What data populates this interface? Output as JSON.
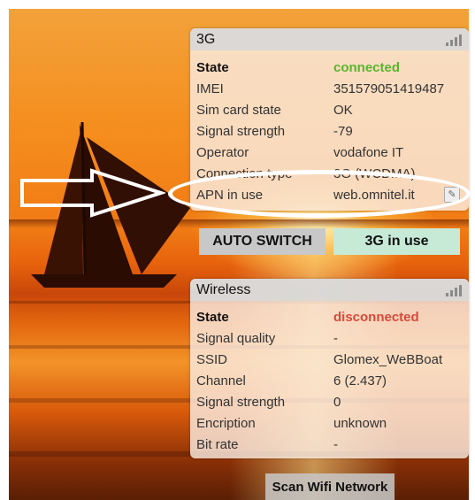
{
  "threeg": {
    "title": "3G",
    "rows": [
      {
        "label": "State",
        "value": "connected"
      },
      {
        "label": "IMEI",
        "value": "351579051419487"
      },
      {
        "label": "Sim card state",
        "value": "OK"
      },
      {
        "label": "Signal strength",
        "value": "-79"
      },
      {
        "label": "Operator",
        "value": "vodafone IT"
      },
      {
        "label": "Connection type",
        "value": "3G (WCDMA)"
      },
      {
        "label": "APN in use",
        "value": "web.omnitel.it"
      }
    ]
  },
  "buttons": {
    "auto_switch": "AUTO SWITCH",
    "threeg_in_use": "3G in use",
    "scan_wifi": "Scan Wifi Network"
  },
  "wireless": {
    "title": "Wireless",
    "rows": [
      {
        "label": "State",
        "value": "disconnected"
      },
      {
        "label": "Signal quality",
        "value": "-"
      },
      {
        "label": "SSID",
        "value": "Glomex_WeBBoat"
      },
      {
        "label": "Channel",
        "value": "6 (2.437)"
      },
      {
        "label": "Signal strength",
        "value": "0"
      },
      {
        "label": "Encription",
        "value": "unknown"
      },
      {
        "label": "Bit rate",
        "value": "-"
      }
    ]
  },
  "colors": {
    "connected": "#5ab52e",
    "disconnected": "#d84a3a",
    "threeg_button": "#c6ead6",
    "auto_button": "#c8c8c8"
  },
  "icons": {
    "signal": "signal-bars-icon",
    "edit": "edit-icon",
    "arrow": "arrow-right-icon"
  }
}
